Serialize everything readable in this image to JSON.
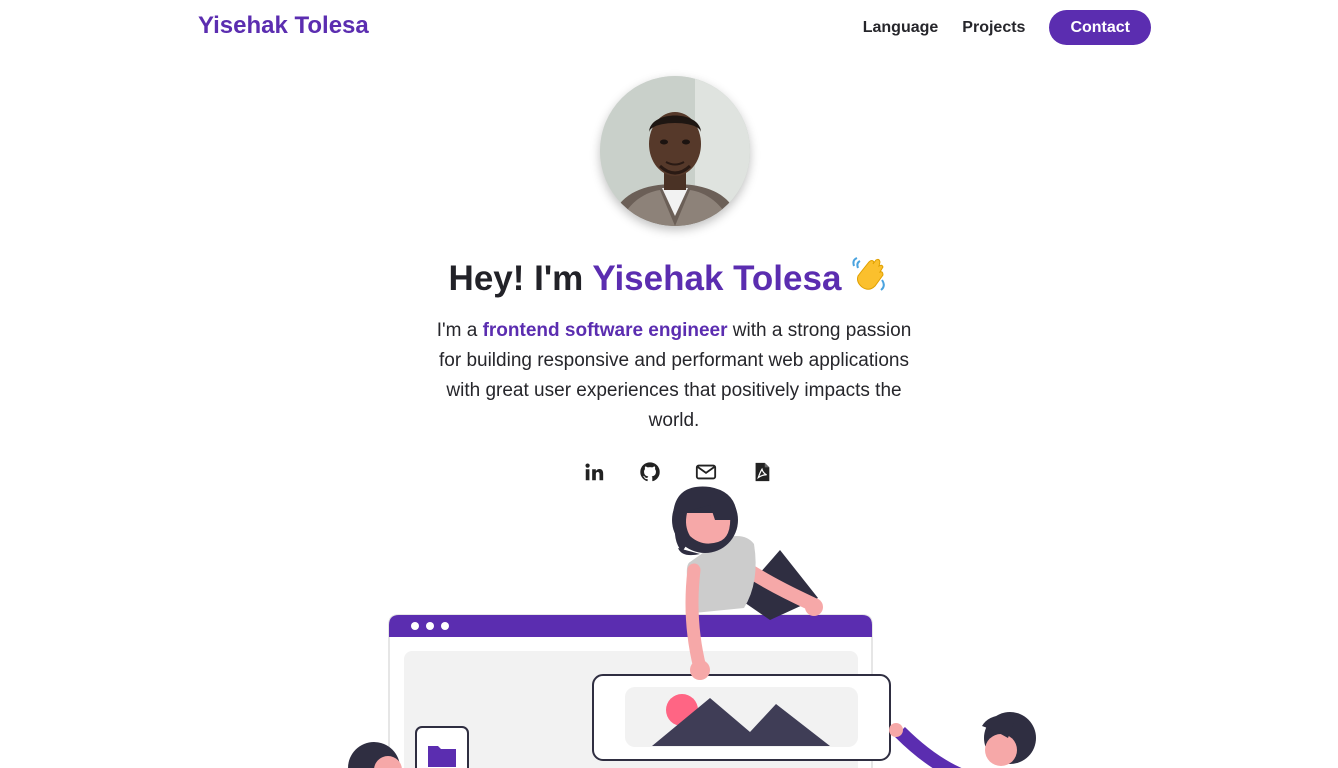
{
  "nav": {
    "brand": "Yisehak Tolesa",
    "links": [
      "Language",
      "Projects"
    ],
    "contact_label": "Contact"
  },
  "hero": {
    "greeting_prefix": "Hey! I'm ",
    "name": "Yisehak Tolesa",
    "wave_icon": "waving-hand-icon",
    "intro_prefix": "I'm a ",
    "intro_highlight": "frontend software engineer",
    "intro_suffix": " with a strong passion for building responsive and performant web applications with great user experiences that positively impacts the world."
  },
  "socials": [
    {
      "name": "linkedin-icon"
    },
    {
      "name": "github-icon"
    },
    {
      "name": "mail-icon"
    },
    {
      "name": "pdf-icon"
    }
  ],
  "colors": {
    "accent": "#5b2db0",
    "text": "#26262b",
    "skin": "#f6a8a8",
    "dark": "#2f2e41",
    "pink": "#ff6584"
  }
}
